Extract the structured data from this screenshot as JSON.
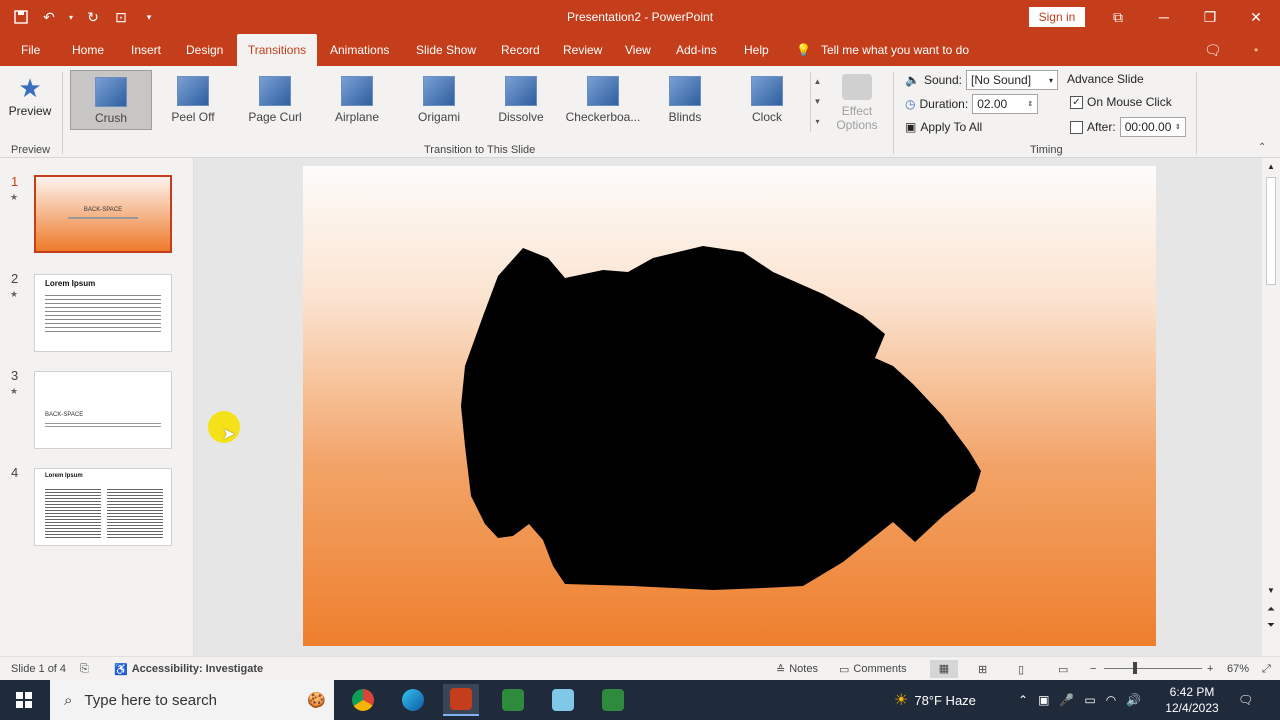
{
  "window": {
    "title": "Presentation2 - PowerPoint",
    "signin_label": "Sign in"
  },
  "tabs": [
    {
      "label": "File"
    },
    {
      "label": "Home"
    },
    {
      "label": "Insert"
    },
    {
      "label": "Design"
    },
    {
      "label": "Transitions"
    },
    {
      "label": "Animations"
    },
    {
      "label": "Slide Show"
    },
    {
      "label": "Record"
    },
    {
      "label": "Review"
    },
    {
      "label": "View"
    },
    {
      "label": "Add-ins"
    },
    {
      "label": "Help"
    }
  ],
  "tellme": "Tell me what you want to do",
  "ribbon": {
    "preview_label": "Preview",
    "preview_group": "Preview",
    "transition_group": "Transition to This Slide",
    "transitions": [
      {
        "label": "Crush",
        "selected": true
      },
      {
        "label": "Peel Off"
      },
      {
        "label": "Page Curl"
      },
      {
        "label": "Airplane"
      },
      {
        "label": "Origami"
      },
      {
        "label": "Dissolve"
      },
      {
        "label": "Checkerboa..."
      },
      {
        "label": "Blinds"
      },
      {
        "label": "Clock"
      }
    ],
    "effect_options_line1": "Effect",
    "effect_options_line2": "Options",
    "timing": {
      "sound_label": "Sound:",
      "sound_value": "[No Sound]",
      "duration_label": "Duration:",
      "duration_value": "02.00",
      "apply_all": "Apply To All",
      "advance_label": "Advance Slide",
      "on_mouse_click": "On Mouse Click",
      "on_mouse_click_checked": true,
      "after_label": "After:",
      "after_checked": false,
      "after_value": "00:00.00",
      "group_label": "Timing"
    }
  },
  "slides": [
    {
      "num": "1",
      "title": "BACK-SPACE",
      "active": true
    },
    {
      "num": "2",
      "title": "Lorem Ipsum"
    },
    {
      "num": "3",
      "title": "BACK-SPACE"
    },
    {
      "num": "4",
      "title": "Lorem Ipsum"
    }
  ],
  "status": {
    "slide_info": "Slide 1 of 4",
    "accessibility": "Accessibility: Investigate",
    "notes": "Notes",
    "comments": "Comments",
    "zoom": "67%"
  },
  "taskbar": {
    "search_placeholder": "Type here to search",
    "weather": "78°F  Haze",
    "time": "6:42 PM",
    "date": "12/4/2023"
  },
  "colors": {
    "accent": "#c43e1c",
    "taskbar": "#1f2a3a"
  }
}
